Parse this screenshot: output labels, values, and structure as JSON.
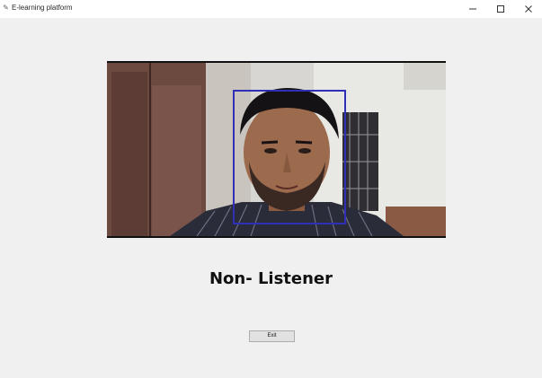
{
  "window": {
    "title": "E-learning platform",
    "controls": {
      "minimize": "—",
      "maximize": "☐",
      "close": "✕"
    }
  },
  "camera": {
    "detection_box_color": "#2f2fb8"
  },
  "status": {
    "label": "Non- Listener"
  },
  "actions": {
    "exit_label": "Exit"
  }
}
